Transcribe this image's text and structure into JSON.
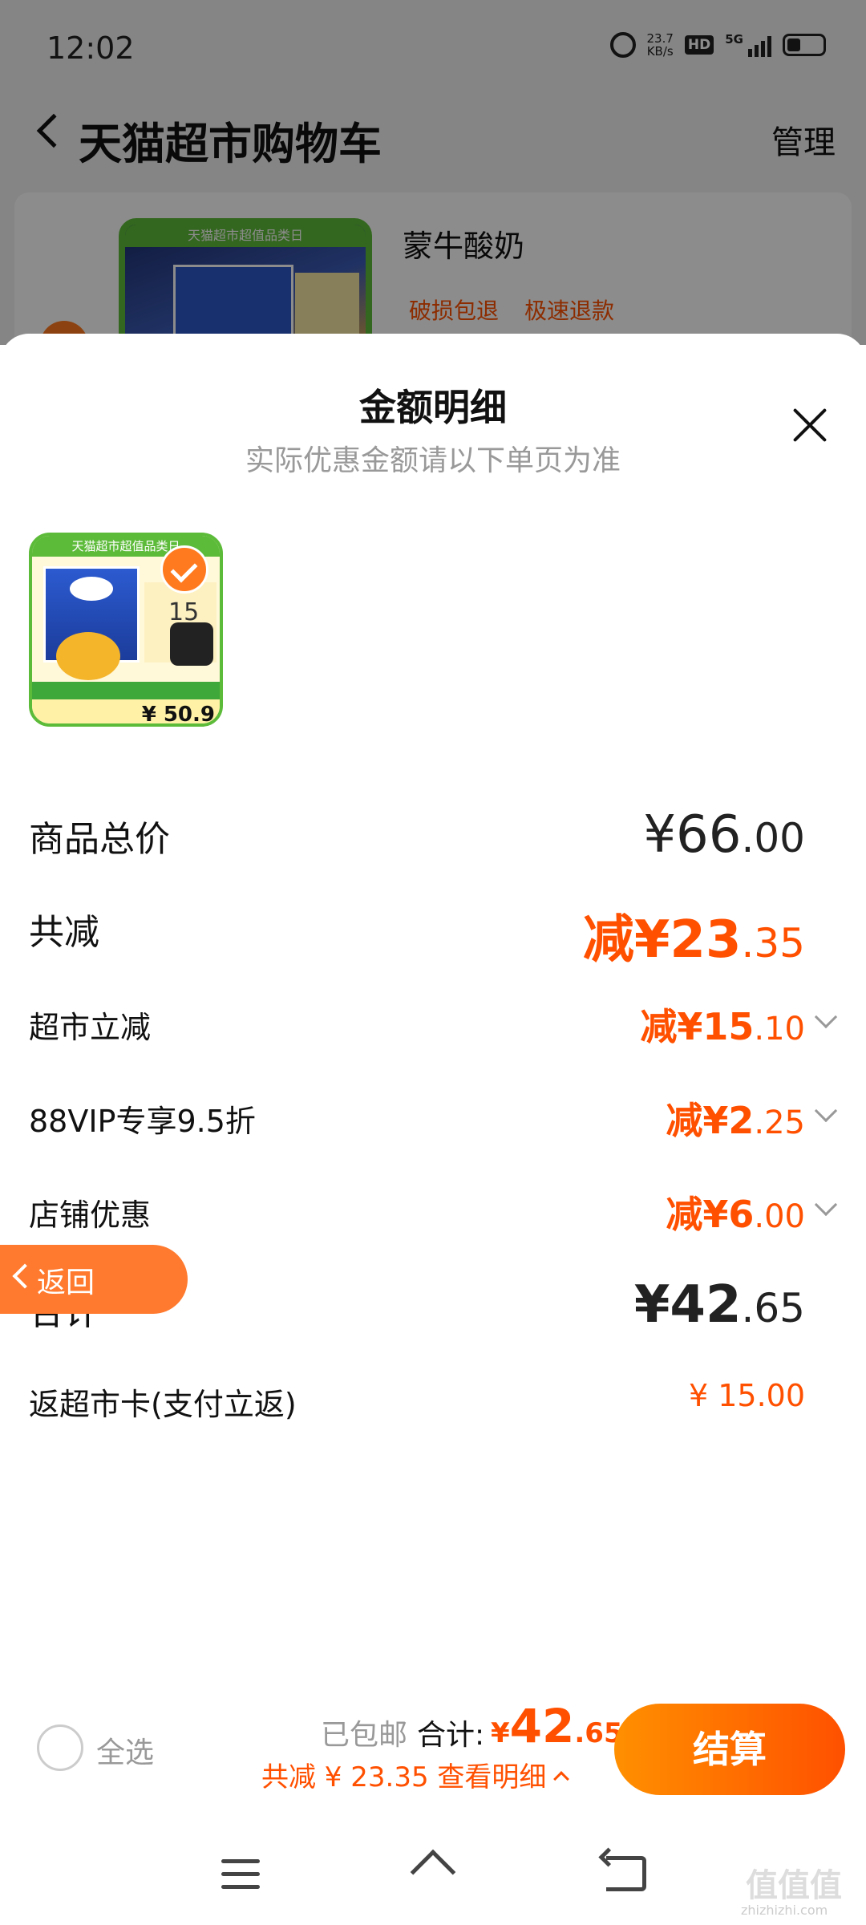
{
  "status_bar": {
    "time": "12:02",
    "net_speed_value": "23.7",
    "net_speed_unit": "KB/s",
    "hd": "HD",
    "network": "5G"
  },
  "nav": {
    "title": "天猫超市购物车",
    "manage": "管理"
  },
  "cart_item": {
    "name": "蒙牛酸奶",
    "tags": [
      "破损包退",
      "极速退款"
    ],
    "thumb_banner": "天猫超市超值品类日"
  },
  "sheet": {
    "title": "金额明细",
    "subtitle": "实际优惠金额请以下单页为准",
    "thumb_banner": "天猫超市超值品类日",
    "thumb_coupon": "15",
    "thumb_price": "¥ 50.9",
    "rows": {
      "goods_total": {
        "label": "商品总价",
        "yen": "¥",
        "int": "66",
        "cents": ".00"
      },
      "total_reduce": {
        "label": "共减",
        "prefix": "减¥",
        "int": "23",
        "cents": ".35"
      },
      "market_reduce": {
        "label": "超市立减",
        "prefix": "减¥",
        "int": "15",
        "cents": ".10"
      },
      "vip_reduce": {
        "label": "88VIP专享9.5折",
        "prefix": "减¥",
        "int": "2",
        "cents": ".25"
      },
      "shop_reduce": {
        "label": "店铺优惠",
        "prefix": "减¥",
        "int": "6",
        "cents": ".00"
      },
      "sum": {
        "label": "合计",
        "yen": "¥",
        "int": "42",
        "cents": ".65"
      },
      "card_return": {
        "label": "返超市卡(支付立返)",
        "value": "¥ 15.00"
      }
    }
  },
  "float_back": {
    "label": "返回"
  },
  "checkout_bar": {
    "select_all": "全选",
    "free_shipping": "已包邮",
    "sum_label": "合计:",
    "sum_symbol": "¥",
    "sum_int": "42",
    "sum_cents": ".65",
    "detail_text": "共减 ¥ 23.35  查看明细",
    "checkout_button": "结算"
  },
  "watermark": {
    "main": "值值值",
    "sub": "zhizhizhi.com"
  },
  "colors": {
    "accent": "#ff5000",
    "accent_light": "#ff9000",
    "float_button": "#ff7a2e",
    "muted_text": "#999999"
  }
}
